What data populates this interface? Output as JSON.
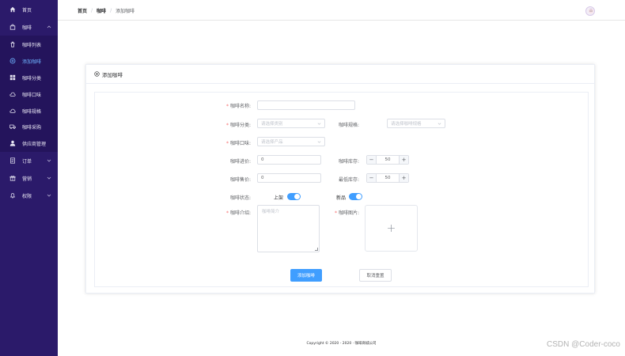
{
  "sidebar": {
    "items": [
      {
        "label": "首页",
        "icon": "home-icon"
      },
      {
        "label": "咖啡",
        "icon": "bag-icon"
      },
      {
        "label": "咖啡列表",
        "icon": "trash-icon"
      },
      {
        "label": "添加咖啡",
        "icon": "plus-circle-icon"
      },
      {
        "label": "咖啡分类",
        "icon": "grid-icon"
      },
      {
        "label": "咖啡口味",
        "icon": "cloud-icon"
      },
      {
        "label": "咖啡规格",
        "icon": "cloud-icon"
      },
      {
        "label": "咖啡采购",
        "icon": "truck-icon"
      },
      {
        "label": "供应商管理",
        "icon": "user-icon"
      },
      {
        "label": "订单",
        "icon": "document-icon"
      },
      {
        "label": "营销",
        "icon": "present-icon"
      },
      {
        "label": "权限",
        "icon": "bell-icon"
      }
    ]
  },
  "header": {
    "breadcrumb": [
      "首页",
      "咖啡",
      "添加咖啡"
    ],
    "separator": "/"
  },
  "card": {
    "title": "添加咖啡"
  },
  "form": {
    "name_label": "咖啡名称:",
    "name_value": "",
    "category_label": "咖啡分类:",
    "category_placeholder": "请选择类别",
    "spec_label": "咖啡规格:",
    "spec_placeholder": "请选择咖啡规格",
    "flavor_label": "咖啡口味:",
    "flavor_placeholder": "请选择产品",
    "cost_label": "咖啡进价:",
    "cost_value": "0",
    "stock_label": "咖啡库存:",
    "stock_value": "50",
    "price_label": "咖啡售价:",
    "price_value": "0",
    "min_stock_label": "最低库存:",
    "min_stock_value": "50",
    "status_label": "咖啡状态:",
    "on_shelf_label": "上架",
    "on_shelf": true,
    "new_label": "新品",
    "is_new": true,
    "intro_label": "咖啡介绍:",
    "intro_placeholder": "咖啡简介",
    "image_label": "咖啡图片:",
    "required_mark": "*",
    "minus": "−",
    "plus": "+",
    "upload_plus": "+"
  },
  "actions": {
    "submit": "添加咖啡",
    "reset": "取消重置"
  },
  "footer": {
    "copyright": "Copyright © 2020 - 2020 · 咖啡商城公司"
  },
  "watermark": "CSDN @Coder-coco",
  "colors": {
    "sidebar": "#2b1a6a",
    "active": "#6fb4ff",
    "primary": "#409eff",
    "required": "#f56c6c"
  }
}
